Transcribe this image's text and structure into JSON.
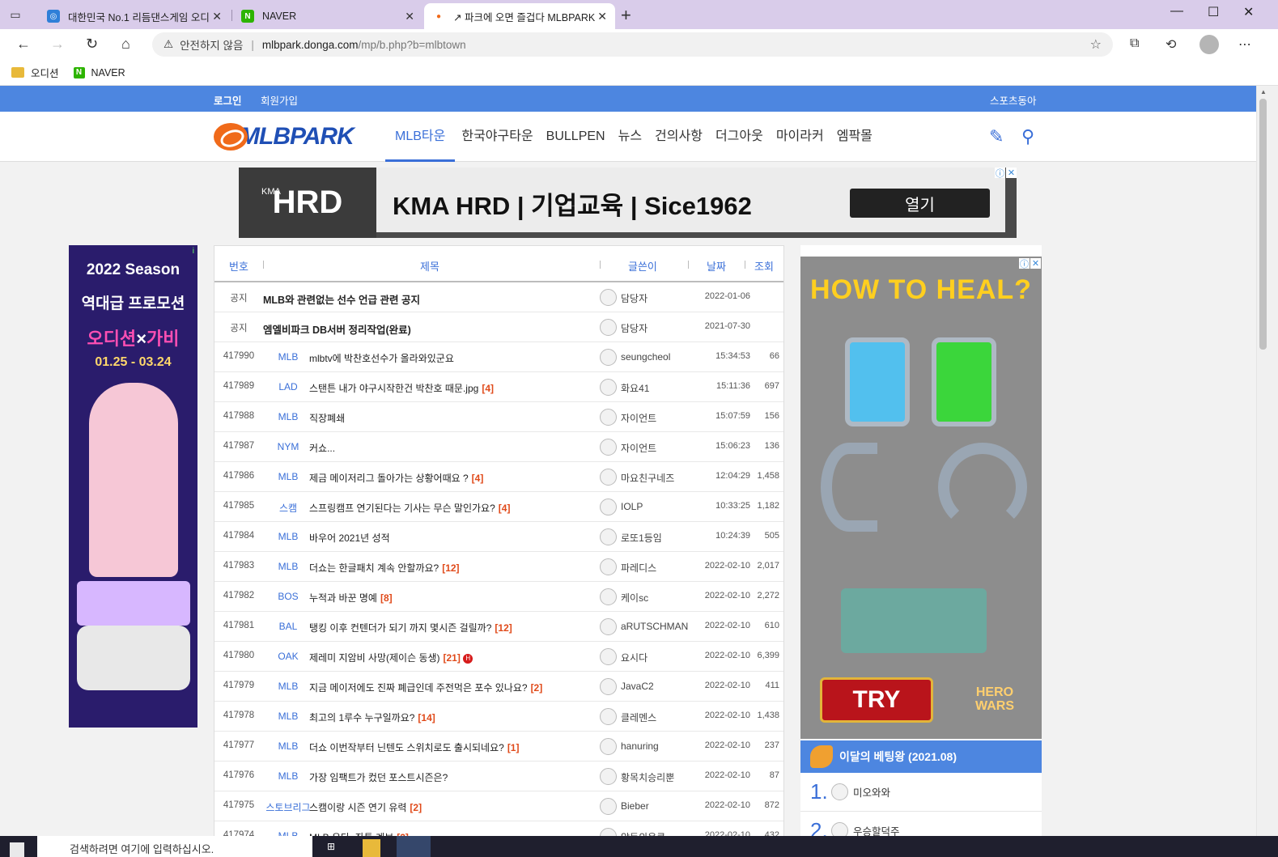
{
  "browser": {
    "tabs": [
      {
        "title": "대한민국 No.1 리듬댄스게임 오디",
        "favicon": "globe-icon"
      },
      {
        "title": "NAVER",
        "favicon": "naver-icon"
      },
      {
        "title": "↗ 파크에 오면 즐겁다 MLBPARK",
        "favicon": "mlbpark-icon",
        "active": true
      }
    ],
    "address": {
      "security_label": "안전하지 않음",
      "host": "mlbpark.donga.com",
      "path": "/mp/b.php?b=mlbtown"
    },
    "bookmarks": [
      {
        "label": "오디션",
        "icon": "folder-icon"
      },
      {
        "label": "NAVER",
        "icon": "naver-icon"
      }
    ]
  },
  "site": {
    "top_links": {
      "login": "로그인",
      "signup": "회원가입",
      "partner": "스포츠동아"
    },
    "logo": "MLBPARK",
    "nav": [
      "MLB타운",
      "한국야구타운",
      "BULLPEN",
      "뉴스",
      "건의사항",
      "더그아웃",
      "마이라커",
      "엠팍몰"
    ],
    "active_nav": "MLB타운"
  },
  "top_banner": {
    "brand_small": "KMA",
    "brand": "HRD",
    "headline": "KMA HRD | 기업교육 | Sice1962",
    "button": "열기"
  },
  "left_ad": {
    "line1": "2022 Season",
    "line2": "역대급 프로모션",
    "logo_a": "오디션",
    "logo_x": "×",
    "logo_b": "가비",
    "dates": "01.25 - 03.24"
  },
  "board": {
    "headers": {
      "num": "번호",
      "title": "제목",
      "writer": "글쓴이",
      "date": "날짜",
      "views": "조회"
    },
    "notices": [
      {
        "label": "공지",
        "title": "MLB와 관련없는 선수 언급 관련 공지",
        "writer": "담당자",
        "date": "2022-01-06"
      },
      {
        "label": "공지",
        "title": "엠엘비파크 DB서버 정리작업(완료)",
        "writer": "담당자",
        "date": "2021-07-30"
      }
    ],
    "posts": [
      {
        "num": "417990",
        "cat": "MLB",
        "title": "mlbtv에 박찬호선수가 올라와있군요",
        "comments": "",
        "writer": "seungcheol",
        "date": "15:34:53",
        "views": "66"
      },
      {
        "num": "417989",
        "cat": "LAD",
        "title": "스탠튼 내가 야구시작한건 박찬호 때문.jpg",
        "comments": "[4]",
        "writer": "화요41",
        "date": "15:11:36",
        "views": "697"
      },
      {
        "num": "417988",
        "cat": "MLB",
        "title": "직장폐쇄",
        "comments": "",
        "writer": "자이언트",
        "date": "15:07:59",
        "views": "156"
      },
      {
        "num": "417987",
        "cat": "NYM",
        "title": "커쇼...",
        "comments": "",
        "writer": "자이언트",
        "date": "15:06:23",
        "views": "136"
      },
      {
        "num": "417986",
        "cat": "MLB",
        "title": "제금 메이저리그 돌아가는 상황어때요 ?",
        "comments": "[4]",
        "writer": "마요친구네즈",
        "date": "12:04:29",
        "views": "1,458"
      },
      {
        "num": "417985",
        "cat": "스캠",
        "title": "스프링캠프 연기된다는 기사는 무슨 말인가요?",
        "comments": "[4]",
        "writer": "IOLP",
        "date": "10:33:25",
        "views": "1,182"
      },
      {
        "num": "417984",
        "cat": "MLB",
        "title": "바우어 2021년 성적",
        "comments": "",
        "writer": "로또1등임",
        "date": "10:24:39",
        "views": "505"
      },
      {
        "num": "417983",
        "cat": "MLB",
        "title": "더쇼는 한글패치 계속 안할까요?",
        "comments": "[12]",
        "writer": "파레디스",
        "date": "2022-02-10",
        "views": "2,017"
      },
      {
        "num": "417982",
        "cat": "BOS",
        "title": "누적과 바꾼 명예",
        "comments": "[8]",
        "writer": "케이sc",
        "date": "2022-02-10",
        "views": "2,272"
      },
      {
        "num": "417981",
        "cat": "BAL",
        "title": "탱킹 이후 컨텐더가 되기 까지 몇시즌 걸릴까?",
        "comments": "[12]",
        "writer": "aRUTSCHMAN",
        "date": "2022-02-10",
        "views": "610"
      },
      {
        "num": "417980",
        "cat": "OAK",
        "title": "제레미 지암비 사망(제이슨 동생)",
        "comments": "[21]",
        "hot": "H",
        "writer": "요시다",
        "date": "2022-02-10",
        "views": "6,399"
      },
      {
        "num": "417979",
        "cat": "MLB",
        "title": "지금 메이저에도 진짜 폐급인데 주전먹은 포수 있나요?",
        "comments": "[2]",
        "writer": "JavaC2",
        "date": "2022-02-10",
        "views": "411"
      },
      {
        "num": "417978",
        "cat": "MLB",
        "title": "최고의 1루수 누구일까요?",
        "comments": "[14]",
        "writer": "클레멘스",
        "date": "2022-02-10",
        "views": "1,438"
      },
      {
        "num": "417977",
        "cat": "MLB",
        "title": "더쇼 이번작부터 닌텐도 스위치로도 출시되네요?",
        "comments": "[1]",
        "writer": "hanuring",
        "date": "2022-02-10",
        "views": "237"
      },
      {
        "num": "417976",
        "cat": "MLB",
        "title": "가장 임팩트가 컸던 포스트시즌은?",
        "comments": "",
        "writer": "황목치승리뿐",
        "date": "2022-02-10",
        "views": "87"
      },
      {
        "num": "417975",
        "cat": "스토브리그",
        "title": "스캠이랑 시즌 연기 유력",
        "comments": "[2]",
        "writer": "Bieber",
        "date": "2022-02-10",
        "views": "872"
      },
      {
        "num": "417974",
        "cat": "MLB",
        "title": "MLB 우타, 좌투 계보",
        "comments": "[2]",
        "writer": "알동의웅쿤",
        "date": "2022-02-10",
        "views": "432"
      }
    ]
  },
  "right_ad": {
    "title": "HOW TO HEAL?",
    "cta": "TRY",
    "brand": "HERO WARS"
  },
  "betting": {
    "title": "이달의 베팅왕 (2021.08)",
    "ranks": [
      {
        "rank": "1.",
        "name": "미오와와"
      },
      {
        "rank": "2.",
        "name": "우승할덕주"
      }
    ]
  },
  "taskbar": {
    "search_placeholder": "검색하려면 여기에 입력하십시오."
  }
}
